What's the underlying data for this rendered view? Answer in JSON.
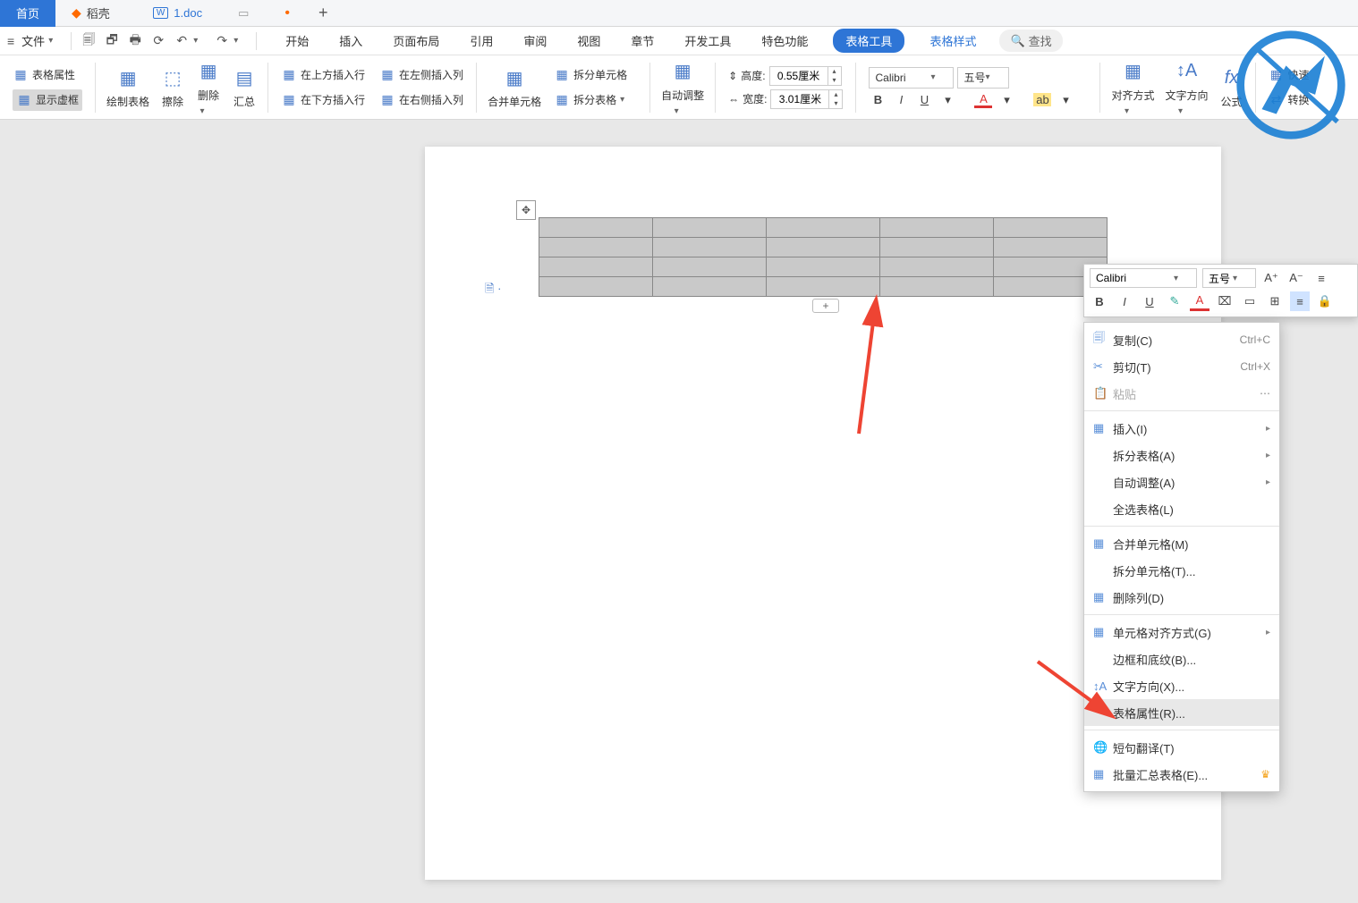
{
  "tabs": {
    "home": "首页",
    "docke": "稻壳",
    "doc": "1.doc"
  },
  "menubar": {
    "file": "文件",
    "menus": [
      "开始",
      "插入",
      "页面布局",
      "引用",
      "审阅",
      "视图",
      "章节",
      "开发工具",
      "特色功能",
      "表格工具",
      "表格样式"
    ],
    "search": "查找"
  },
  "ribbon": {
    "props": "表格属性",
    "showdash": "显示虚框",
    "draw": "绘制表格",
    "erase": "擦除",
    "delete": "删除",
    "sum": "汇总",
    "insAbove": "在上方插入行",
    "insBelow": "在下方插入行",
    "insLeft": "在左侧插入列",
    "insRight": "在右侧插入列",
    "merge": "合并单元格",
    "splitCell": "拆分单元格",
    "splitTable": "拆分表格",
    "autofit": "自动调整",
    "height": "高度:",
    "heightVal": "0.55厘米",
    "width": "宽度:",
    "widthVal": "3.01厘米",
    "font": "Calibri",
    "fontSize": "五号",
    "align": "对齐方式",
    "textdir": "文字方向",
    "formula": "公式",
    "quick": "快速",
    "convert": "转换"
  },
  "mini": {
    "font": "Calibri",
    "size": "五号"
  },
  "ctx": {
    "copy": "复制(C)",
    "copyShort": "Ctrl+C",
    "cut": "剪切(T)",
    "cutShort": "Ctrl+X",
    "paste": "粘贴",
    "insert": "插入(I)",
    "splitTable": "拆分表格(A)",
    "autofit": "自动调整(A)",
    "selectTable": "全选表格(L)",
    "merge": "合并单元格(M)",
    "splitCell": "拆分单元格(T)...",
    "delCol": "删除列(D)",
    "cellAlign": "单元格对齐方式(G)",
    "border": "边框和底纹(B)...",
    "textdir": "文字方向(X)...",
    "tableProps": "表格属性(R)...",
    "translate": "短句翻译(T)",
    "batch": "批量汇总表格(E)..."
  }
}
